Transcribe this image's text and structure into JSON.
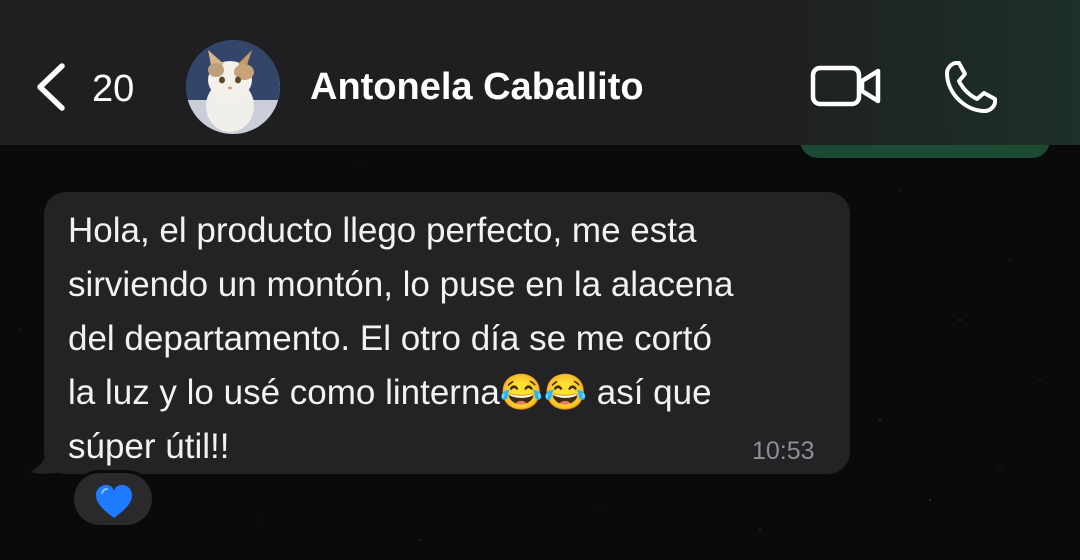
{
  "header": {
    "back_count": "20",
    "contact_name": "Antonela Caballito",
    "icons": {
      "back": "chevron-left-icon",
      "avatar": "contact-avatar",
      "video": "video-camera-icon",
      "call": "phone-icon"
    }
  },
  "message": {
    "text": "Hola, el producto llego perfecto, me esta\nsirviendo un montón, lo puse en la alacena\ndel departamento. El otro día se me cortó\nla luz y lo usé como linterna😂😂 así que\nsúper útil!!",
    "time": "10:53",
    "reaction": "💙"
  },
  "colors": {
    "header_bg": "#1f1f21",
    "bubble_bg": "#232325",
    "accent_green": "#1c4a33",
    "reaction_heart": "#1e7bff"
  }
}
